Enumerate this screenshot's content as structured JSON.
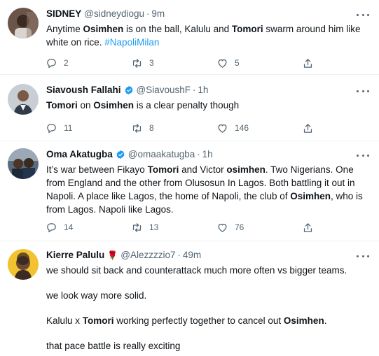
{
  "tweets": [
    {
      "name": "SIDNEY",
      "handle": "@sidneydiogu",
      "time": "9m",
      "verified": false,
      "text_parts": [
        {
          "t": "Anytime "
        },
        {
          "t": "Osimhen",
          "b": true
        },
        {
          "t": " is on the ball, Kalulu and "
        },
        {
          "t": "Tomori",
          "b": true
        },
        {
          "t": " swarm around him like white on rice. "
        },
        {
          "t": "#NapoliMilan",
          "tag": true
        }
      ],
      "replies": "2",
      "retweets": "3",
      "likes": "5"
    },
    {
      "name": "Siavoush Fallahi",
      "handle": "@SiavoushF",
      "time": "1h",
      "verified": true,
      "text_parts": [
        {
          "t": "Tomori",
          "b": true
        },
        {
          "t": " on "
        },
        {
          "t": "Osimhen",
          "b": true
        },
        {
          "t": " is a clear penalty though"
        }
      ],
      "replies": "11",
      "retweets": "8",
      "likes": "146"
    },
    {
      "name": "Oma Akatugba",
      "handle": "@omaakatugba",
      "time": "1h",
      "verified": true,
      "text_parts": [
        {
          "t": "It’s war between Fikayo "
        },
        {
          "t": "Tomori",
          "b": true
        },
        {
          "t": " and Victor "
        },
        {
          "t": "osimhen",
          "b": true
        },
        {
          "t": ". Two Nigerians. One from England and the other from Olusosun In Lagos. Both battling it out in Napoli. A place like Lagos, the home of Napoli, the club of "
        },
        {
          "t": "Osimhen",
          "b": true
        },
        {
          "t": ", who is from Lagos. Napoli like Lagos."
        }
      ],
      "replies": "14",
      "retweets": "13",
      "likes": "76"
    },
    {
      "name": "Kierre Palulu",
      "name_emoji": "🌹",
      "handle": "@Alezzzzio7",
      "time": "49m",
      "verified": false,
      "paragraphs": [
        [
          {
            "t": "we should sit back and counterattack much more often vs bigger teams."
          }
        ],
        [
          {
            "t": "we look way more solid."
          }
        ],
        [
          {
            "t": "Kalulu x "
          },
          {
            "t": "Tomori",
            "b": true
          },
          {
            "t": " working perfectly together to cancel out "
          },
          {
            "t": "Osimhen",
            "b": true
          },
          {
            "t": "."
          }
        ],
        [
          {
            "t": "that pace battle is really exciting"
          }
        ]
      ]
    }
  ],
  "separator": "·",
  "colors": {
    "accent": "#1d9bf0",
    "secondary_text": "#536471",
    "divider": "#eff3f4"
  },
  "icons": [
    "reply-icon",
    "retweet-icon",
    "like-icon",
    "share-icon",
    "verified-badge-icon",
    "more-options-icon"
  ]
}
